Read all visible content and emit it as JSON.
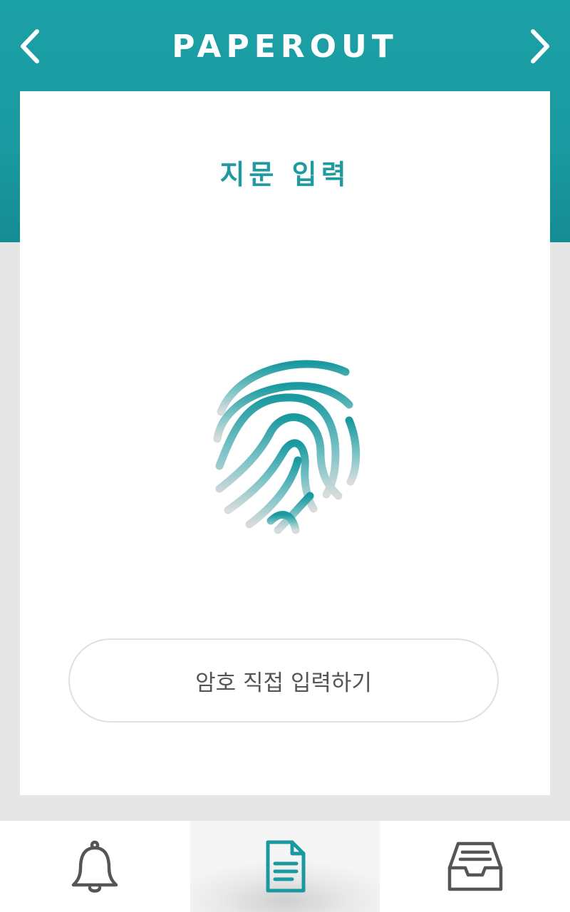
{
  "app": {
    "title": "PAPEROUT"
  },
  "nav": {
    "prev_icon": "chevron-left-icon",
    "next_icon": "chevron-right-icon"
  },
  "card": {
    "title": "지문 입력",
    "fingerprint_icon": "fingerprint-icon",
    "password_button_label": "암호 직접 입력하기"
  },
  "tabs": [
    {
      "icon": "bell-icon",
      "active": false
    },
    {
      "icon": "document-icon",
      "active": true
    },
    {
      "icon": "inbox-tray-icon",
      "active": false
    }
  ],
  "colors": {
    "accent": "#1ba0a6",
    "background": "#e6e6e6",
    "icon_gray": "#555555"
  }
}
